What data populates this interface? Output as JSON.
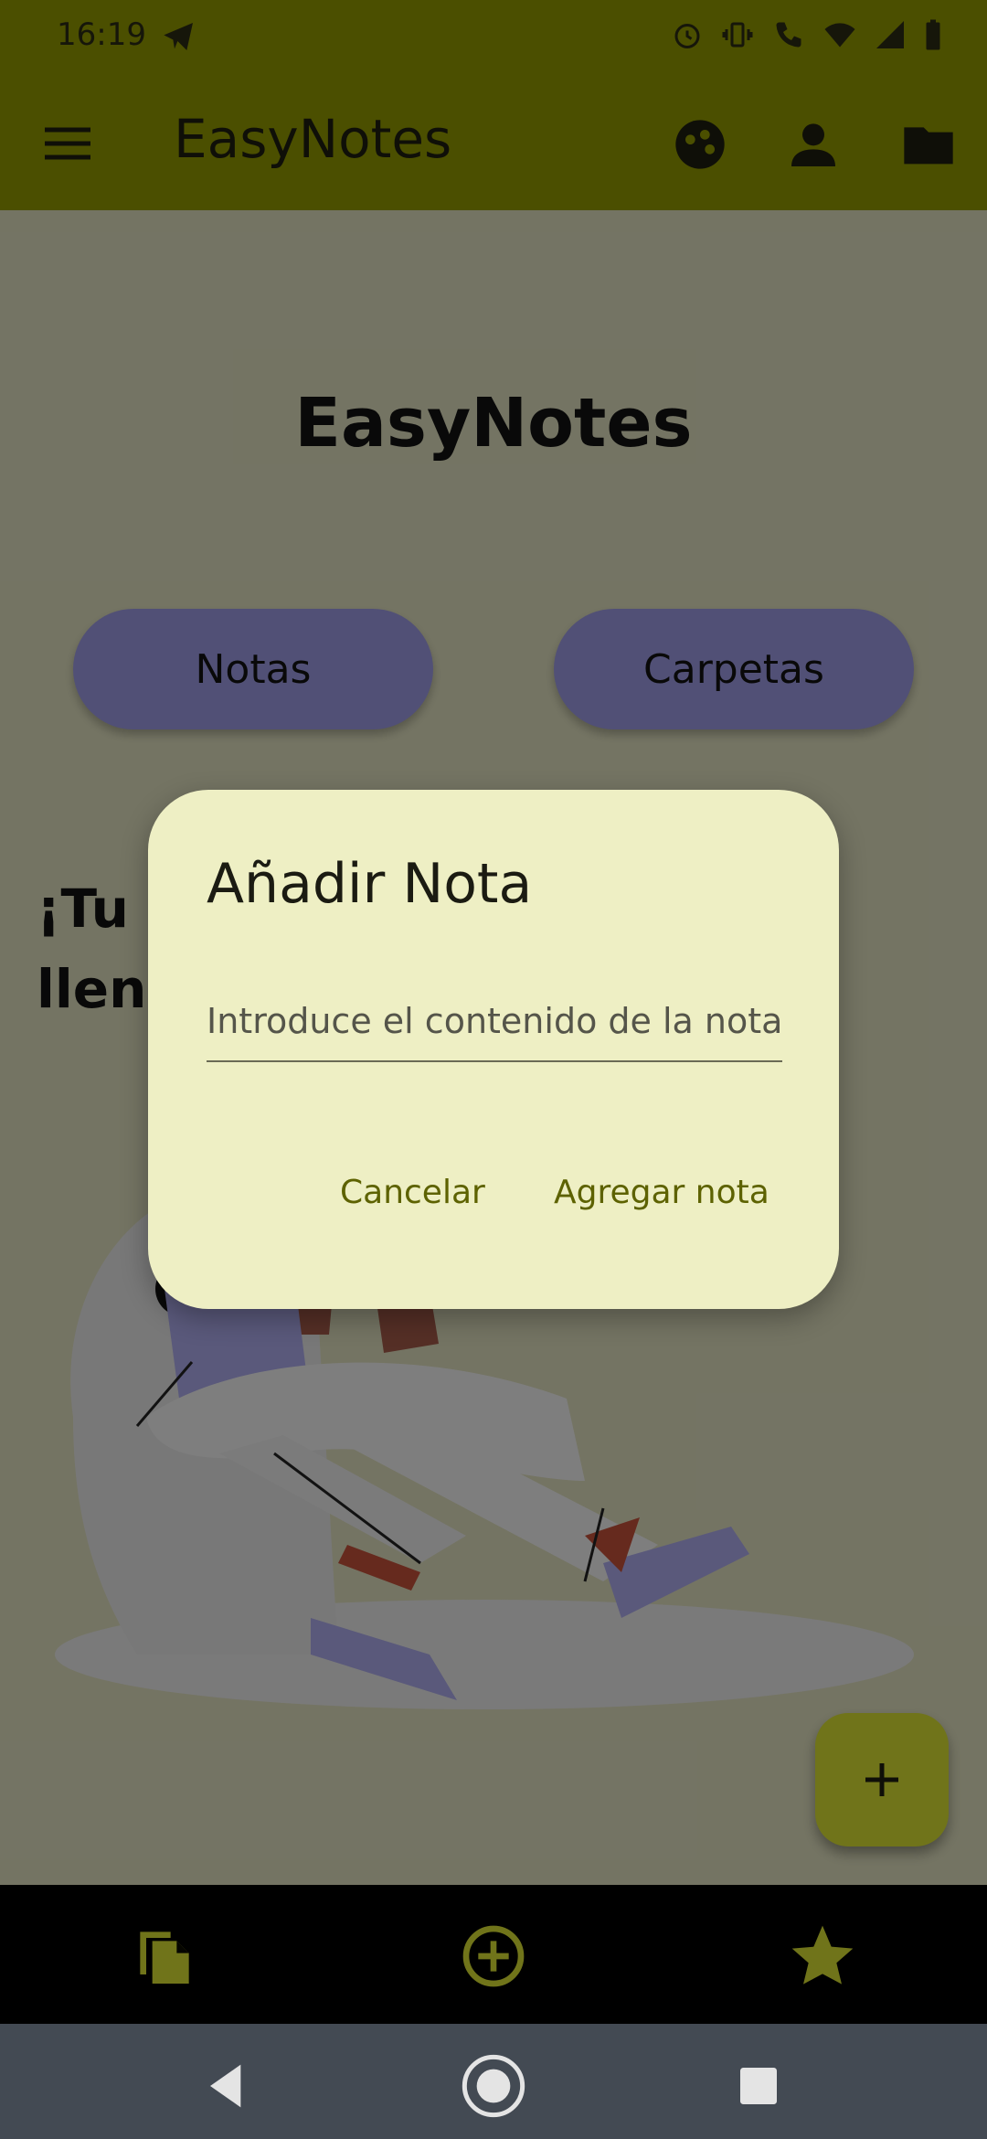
{
  "status_bar": {
    "time": "16:19",
    "left_icons": [
      "telegram-icon"
    ],
    "right_icons": [
      "alarm-icon",
      "vibrate-icon",
      "volte-4g-call-icon",
      "wifi-icon",
      "cell-signal-icon",
      "battery-icon"
    ]
  },
  "app_bar": {
    "title": "EasyNotes",
    "menu_icon": "hamburger-menu-icon",
    "actions": [
      "theme-palette-icon",
      "profile-icon",
      "folder-icon"
    ]
  },
  "main": {
    "title": "EasyNotes",
    "buttons": {
      "notes": "Notas",
      "folders": "Carpetas"
    },
    "empty_message": "¡Tu e\nllena",
    "fab_icon": "plus-icon"
  },
  "bottom_nav": [
    "notes-copy-icon",
    "add-circle-icon",
    "star-icon"
  ],
  "system_nav": [
    "back-icon",
    "home-icon",
    "recents-icon"
  ],
  "dialog": {
    "title": "Añadir Nota",
    "input_placeholder": "Introduce el contenido de la nota",
    "input_value": "",
    "cancel_label": "Cancelar",
    "confirm_label": "Agregar nota"
  },
  "colors": {
    "primary": "#8e9500",
    "pill": "#9a97df",
    "fab": "#d4db31",
    "dialog_bg": "#eeefc4",
    "dialog_action": "#5d6200"
  }
}
